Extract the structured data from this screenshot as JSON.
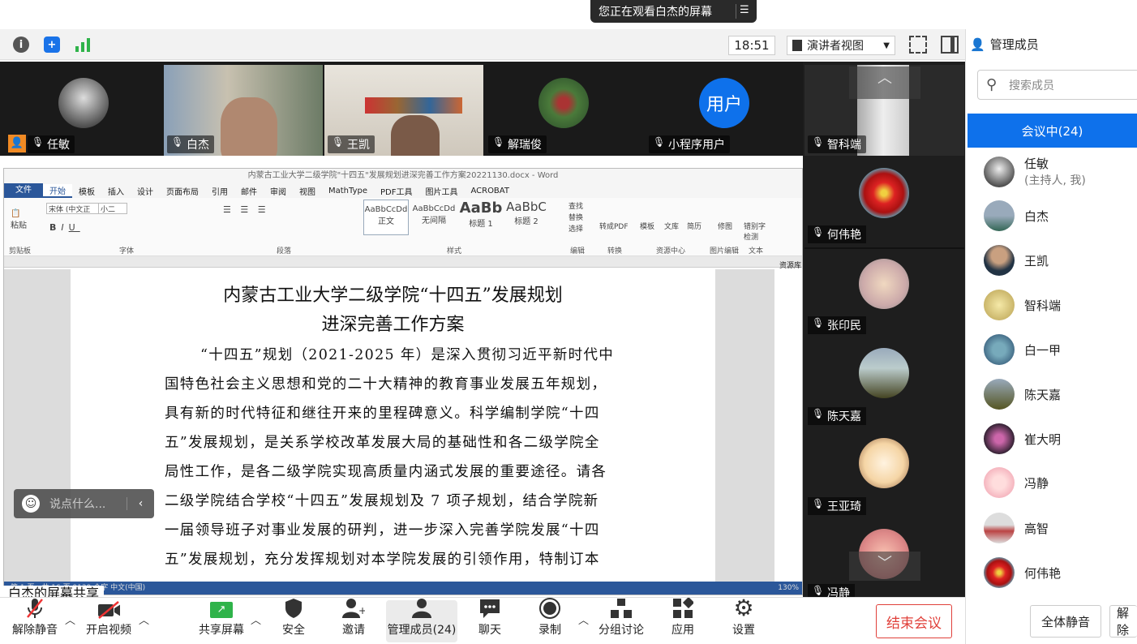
{
  "banner": {
    "text": "您正在观看白杰的屏幕"
  },
  "topbar": {
    "time": "18:51",
    "view_label": "演讲者视图"
  },
  "videos": [
    {
      "name": "任敏"
    },
    {
      "name": "白杰"
    },
    {
      "name": "王凯"
    },
    {
      "name": "解瑞俊"
    },
    {
      "name": "小程序用户",
      "avatar_text": "用户"
    },
    {
      "name": "智科端"
    }
  ],
  "right_videos": [
    {
      "name": "何伟艳"
    },
    {
      "name": "张印民"
    },
    {
      "name": "陈天嘉"
    },
    {
      "name": "王亚琦"
    },
    {
      "name": "冯静"
    }
  ],
  "word": {
    "title_bar": "内蒙古工业大学二级学院\"十四五\"发展规划进深完善工作方案20221130.docx - Word",
    "menu": [
      "文件",
      "开始",
      "模板",
      "插入",
      "设计",
      "页面布局",
      "引用",
      "邮件",
      "审阅",
      "视图",
      "MathType",
      "PDF工具",
      "图片工具",
      "ACROBAT"
    ],
    "font_name": "宋体 (中文正",
    "font_size": "小二",
    "styles": [
      "正文",
      "无间隔",
      "标题 1",
      "标题 2"
    ],
    "group_labels": [
      "剪贴板",
      "字体",
      "段落",
      "样式",
      "编辑",
      "转换",
      "资源中心",
      "图片编辑",
      "文本"
    ],
    "tools": [
      "查找",
      "替换",
      "选择",
      "转成PDF",
      "模板",
      "文库",
      "简历",
      "修图",
      "错别字检测"
    ],
    "doc_title_1": "内蒙古工业大学二级学院“十四五”发展规划",
    "doc_title_2": "进深完善工作方案",
    "lines": [
      "“十四五”规划（2021-2025 年）是深入贯彻习近平新时代中",
      "国特色社会主义思想和党的二十大精神的教育事业发展五年规划，",
      "具有新的时代特征和继往开来的里程碑意义。科学编制学院“十四",
      "五”发展规划，是关系学校改革发展大局的基础性和各二级学院全",
      "局性工作，是各二级学院实现高质量内涵式发展的重要途径。请各",
      "二级学院结合学校“十四五”发展规划及 7 项子规划，结合学院新",
      "一届领导班子对事业发展的研判，进一步深入完善学院发展“十四",
      "五”发展规划，充分发挥规划对本学院发展的引领作用，特制订本"
    ],
    "status": "第 1 页，共 16 页    9139 个字    中文(中国)",
    "zoom": "130%",
    "side_panel": "资源库"
  },
  "chat_placeholder": "说点什么...",
  "share_label": "白杰的屏幕共享",
  "bottom": {
    "mute": "解除静音",
    "video": "开启视频",
    "share": "共享屏幕",
    "security": "安全",
    "invite": "邀请",
    "manage": "管理成员(24)",
    "chat": "聊天",
    "record": "录制",
    "breakout": "分组讨论",
    "apps": "应用",
    "settings": "设置",
    "end": "结束会议"
  },
  "sidebar": {
    "title": "管理成员",
    "search_placeholder": "搜索成员",
    "in_meeting": "会议中(24)",
    "members": [
      {
        "name": "任敏",
        "sub": "(主持人, 我)"
      },
      {
        "name": "白杰"
      },
      {
        "name": "王凯"
      },
      {
        "name": "智科端"
      },
      {
        "name": "白一甲"
      },
      {
        "name": "陈天嘉"
      },
      {
        "name": "崔大明"
      },
      {
        "name": "冯静"
      },
      {
        "name": "高智"
      },
      {
        "name": "何伟艳"
      }
    ],
    "mute_all": "全体静音",
    "unmute_all": "解除"
  },
  "colors": {
    "accent": "#0e71eb",
    "end": "#e0403a",
    "word_blue": "#2b579a"
  }
}
